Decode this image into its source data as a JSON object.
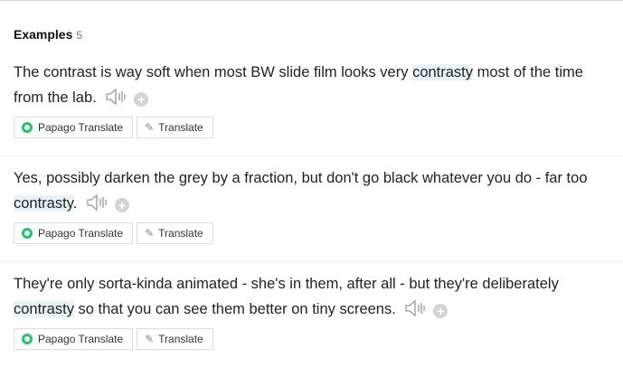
{
  "section": {
    "title": "Examples",
    "count": "5"
  },
  "icons": {
    "speaker": "speaker-icon",
    "add": "plus-icon",
    "papago": "papago-logo-icon",
    "translate": "pencil-icon"
  },
  "colors": {
    "highlight": "#e6f3fb",
    "papago_green": "#1ec76b"
  },
  "examples": [
    {
      "before": "The contrast is way soft when most BW slide film looks very ",
      "keyword": "contrasty",
      "after": " most of the time from the lab.",
      "papago_label": "Papago Translate",
      "translate_label": "Translate"
    },
    {
      "before": "Yes, possibly darken the grey by a fraction, but don't go black whatever you do - far too ",
      "keyword": "contrasty",
      "after": ".",
      "papago_label": "Papago Translate",
      "translate_label": "Translate"
    },
    {
      "before": "They're only sorta-kinda animated - she's in them, after all - but they're deliberately ",
      "keyword": "contrasty",
      "after": " so that you can see them better on tiny screens.",
      "papago_label": "Papago Translate",
      "translate_label": "Translate"
    }
  ]
}
